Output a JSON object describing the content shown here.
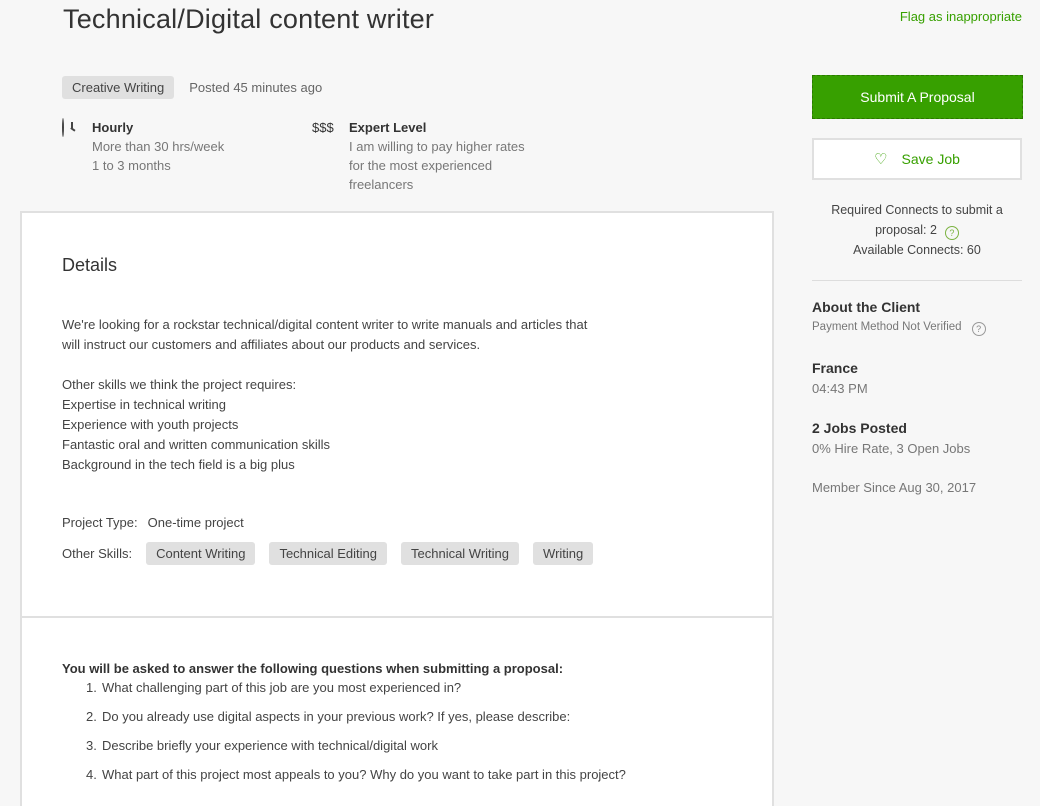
{
  "job": {
    "title": "Technical/Digital content writer",
    "flag_label": "Flag as inappropriate",
    "category": "Creative Writing",
    "posted": "Posted 45 minutes ago",
    "hourly": {
      "title": "Hourly",
      "line1": "More than 30 hrs/week",
      "line2": "1 to 3 months"
    },
    "level": {
      "icon": "$$$",
      "title": "Expert Level",
      "line1": "I am willing to pay higher rates",
      "line2": "for the most experienced",
      "line3": "freelancers"
    }
  },
  "details": {
    "heading": "Details",
    "desc_line1": "We're looking for a rockstar technical/digital content writer to write manuals and articles that",
    "desc_line2": "will instruct our customers and affiliates about our products and services.",
    "skills_intro": "Other skills we think the project requires:",
    "req1": "Expertise in technical writing",
    "req2": "Experience with youth projects",
    "req3": "Fantastic oral and written communication skills",
    "req4": "Background in the tech field is a big plus",
    "project_type_label": "Project Type:",
    "project_type_value": "One-time project",
    "other_skills_label": "Other Skills:",
    "skills": [
      "Content Writing",
      "Technical Editing",
      "Technical Writing",
      "Writing"
    ]
  },
  "questions": {
    "intro": "You will be asked to answer the following questions when submitting a proposal:",
    "items": [
      {
        "num": "1.",
        "text": "What challenging part of this job are you most experienced in?"
      },
      {
        "num": "2.",
        "text": "Do you already use digital aspects in your previous work? If yes, please describe:"
      },
      {
        "num": "3.",
        "text": "Describe briefly your experience with technical/digital work"
      },
      {
        "num": "4.",
        "text": "What part of this project most appeals to you? Why do you want to take part in this project?"
      }
    ]
  },
  "sidebar": {
    "submit_label": "Submit A Proposal",
    "save_label": "Save Job",
    "connects_line1": "Required Connects to submit a",
    "connects_line2": "proposal: 2",
    "connects_line3": "Available Connects: 60",
    "help_glyph": "?",
    "client_heading": "About the Client",
    "payment": "Payment Method Not Verified",
    "country": "France",
    "local_time": "04:43 PM",
    "jobs_posted": "2 Jobs Posted",
    "hire_rate": "0% Hire Rate, 3 Open Jobs",
    "member_since": "Member Since Aug 30, 2017"
  },
  "colors": {
    "accent": "#37a000",
    "badge_bg": "#e0e0e0"
  }
}
